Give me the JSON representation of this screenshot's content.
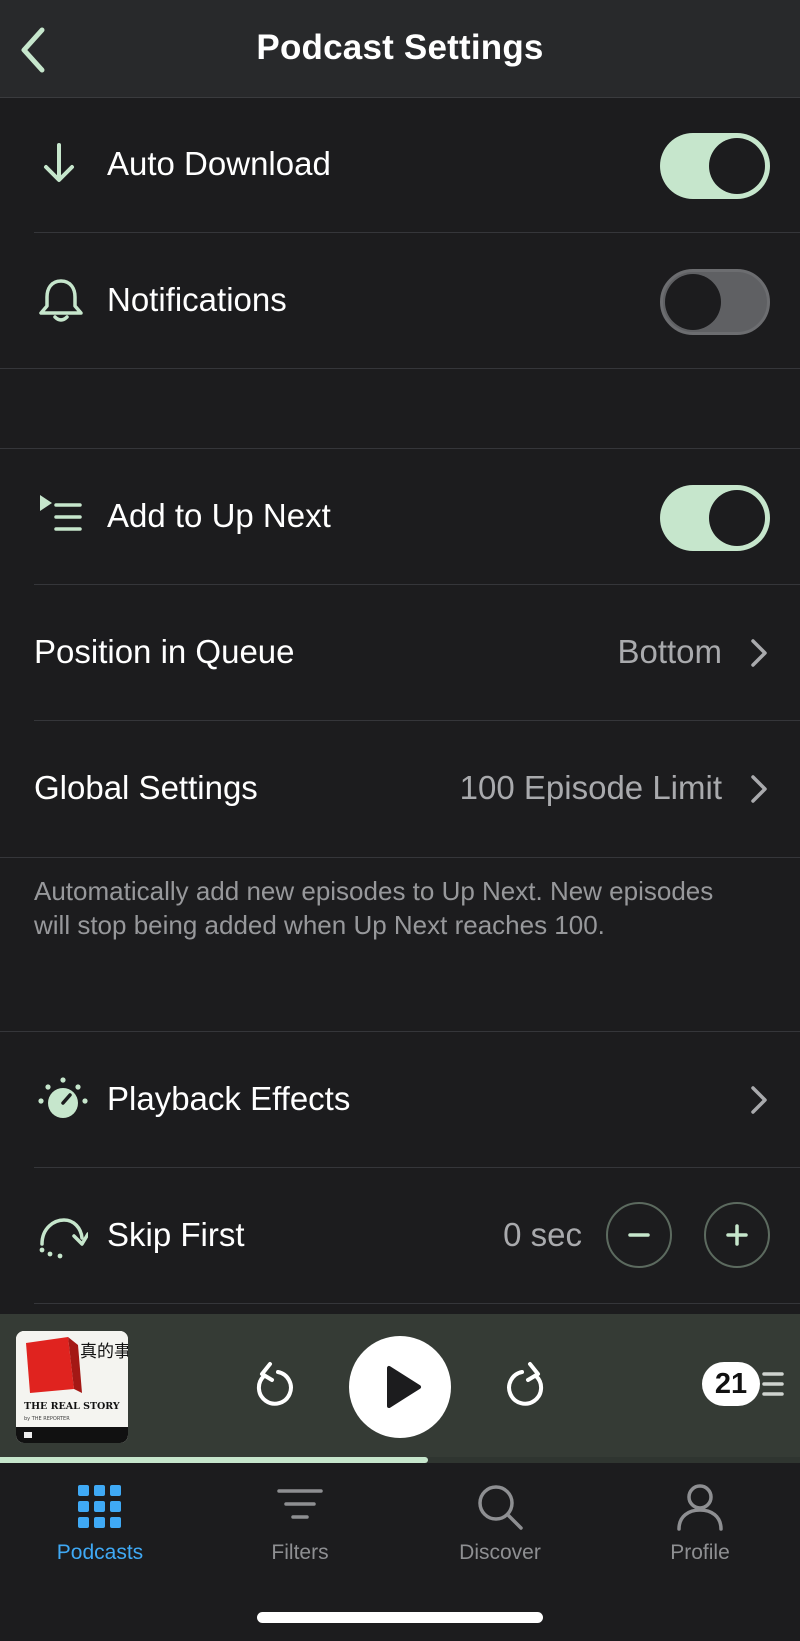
{
  "header": {
    "title": "Podcast Settings"
  },
  "settings": {
    "auto_download": {
      "label": "Auto Download",
      "enabled": true
    },
    "notifications": {
      "label": "Notifications",
      "enabled": false
    },
    "add_to_up_next": {
      "label": "Add to Up Next",
      "enabled": true
    },
    "position_in_queue": {
      "label": "Position in Queue",
      "value": "Bottom"
    },
    "global_settings": {
      "label": "Global Settings",
      "value": "100 Episode Limit"
    },
    "description": "Automatically add new episodes to Up Next. New episodes will stop being added when Up Next reaches 100.",
    "playback_effects": {
      "label": "Playback Effects"
    },
    "skip_first": {
      "label": "Skip First",
      "value": "0 sec"
    }
  },
  "player": {
    "artwork_title": "THE REAL STORY",
    "artwork_subtitle": "by THE REPORTER",
    "artwork_cjk": "真的事",
    "up_next_count": "21",
    "progress_fraction": 0.535
  },
  "tabs": [
    {
      "label": "Podcasts",
      "icon": "grid-icon",
      "active": true
    },
    {
      "label": "Filters",
      "icon": "filter-icon",
      "active": false
    },
    {
      "label": "Discover",
      "icon": "search-icon",
      "active": false
    },
    {
      "label": "Profile",
      "icon": "profile-icon",
      "active": false
    }
  ],
  "colors": {
    "accent_green": "#c6e6cc",
    "tab_active": "#3fa9f5",
    "background": "#1c1c1e"
  }
}
